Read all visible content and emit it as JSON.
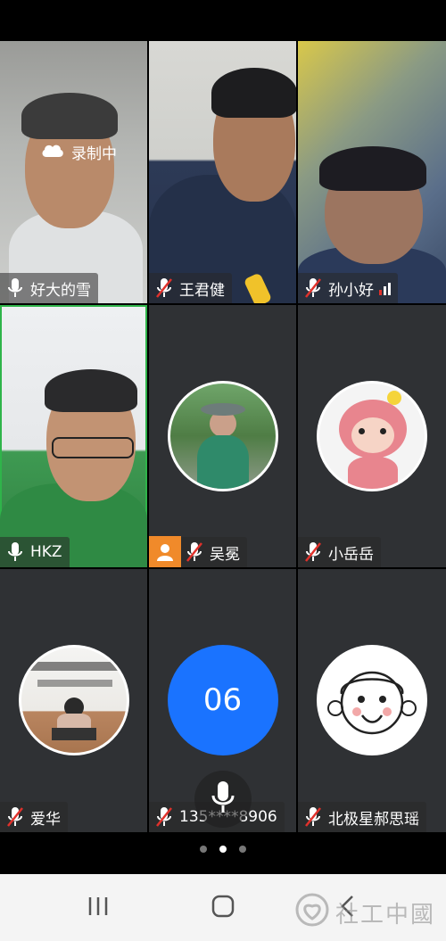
{
  "recording": {
    "label": "录制中"
  },
  "participants": [
    {
      "name": "好大的雪",
      "mic": "on"
    },
    {
      "name": "王君健",
      "mic": "muted"
    },
    {
      "name": "孙小好",
      "mic": "muted"
    },
    {
      "name": "HKZ",
      "mic": "on"
    },
    {
      "name": "吴冕",
      "mic": "muted",
      "host": true
    },
    {
      "name": "小岳岳",
      "mic": "muted"
    },
    {
      "name": "爱华",
      "mic": "muted"
    },
    {
      "name": "135****8906",
      "mic": "muted",
      "avatar_text": "06"
    },
    {
      "name": "北极星郝思瑶",
      "mic": "muted"
    }
  ],
  "pager": {
    "pages": 3,
    "current_index": 1
  },
  "colors": {
    "active_speaker": "#2fb44a",
    "host_badge": "#f08a2a",
    "number_avatar": "#1a73ff",
    "mute_slash": "#e0312b"
  },
  "icons": {
    "record": "cloud-icon",
    "mic": "microphone-icon",
    "mic_muted": "mic-muted-icon",
    "host": "person-icon"
  },
  "navigation": {
    "recent": "recent-apps-button",
    "home": "home-button",
    "back": "back-button"
  },
  "watermark": {
    "text": "社工中國"
  }
}
